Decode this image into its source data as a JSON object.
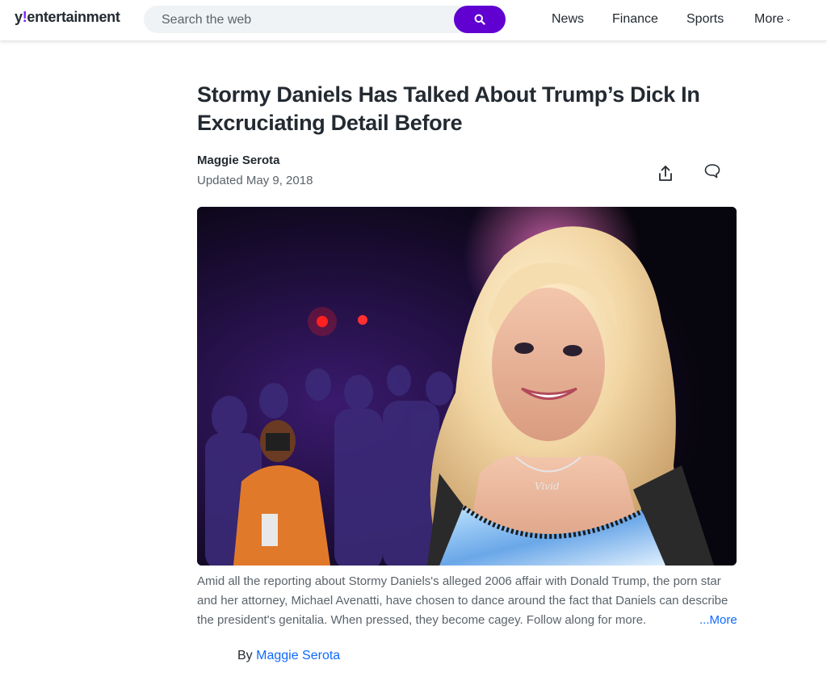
{
  "header": {
    "logo_y": "y",
    "logo_bang": "!",
    "logo_text": "entertainment",
    "search_placeholder": "Search the web",
    "nav": [
      "News",
      "Finance",
      "Sports",
      "More"
    ]
  },
  "article": {
    "title": "Stormy Daniels Has Talked About Trump’s Dick In Excruciating Detail Before",
    "author": "Maggie Serota",
    "updated": "Updated May 9, 2018",
    "summary": "Amid all the reporting about Stormy Daniels's alleged 2006 affair with Donald Trump, the porn star and her attorney, Michael Avenatti, have chosen to dance around the fact that Daniels can describe the president's genitalia. When pressed, they become cagey. Follow along for more.",
    "more_label": "...More",
    "byline_prefix": "By",
    "byline_author": "Maggie Serota"
  },
  "icons": {
    "search": "search-icon",
    "share": "share-icon",
    "comment": "comment-icon",
    "chevron": "chevron-down-icon"
  },
  "colors": {
    "brand_purple": "#6001d2",
    "link_blue": "#0f69ff",
    "text": "#232a31",
    "muted": "#5b636a"
  }
}
